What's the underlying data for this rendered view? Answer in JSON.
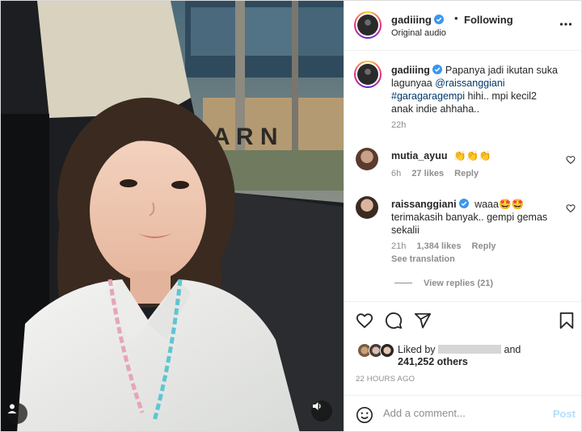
{
  "post": {
    "username": "gadiiing",
    "follow_dot": "•",
    "follow_status": "Following",
    "audio": "Original audio"
  },
  "caption": {
    "username": "gadiiing",
    "text_before": "Papanya jadi ikutan suka lagunyaa ",
    "mention": "@raissanggiani",
    "hashtag": "#garagaragempi",
    "text_after": " hihi.. mpi kecil2 anak indie ahhaha..",
    "time": "22h"
  },
  "comments": [
    {
      "username": "mutia_ayuu",
      "text": "👏👏👏",
      "time": "6h",
      "likes": "27 likes",
      "reply": "Reply"
    },
    {
      "username": "raissanggiani",
      "text": "waaa🤩🤩 terimakasih banyak.. gempi gemas sekalii",
      "time": "21h",
      "likes": "1,384 likes",
      "reply": "Reply",
      "see_translation": "See translation",
      "view_replies": "View replies (21)"
    }
  ],
  "likes": {
    "prefix": "Liked by",
    "suffix": "and",
    "count": "241,252 others"
  },
  "timestamp": "22 HOURS AGO",
  "add_comment": {
    "placeholder": "Add a comment...",
    "post_label": "Post"
  },
  "colors": {
    "verified": "#3897f0",
    "link": "#00376b",
    "muted": "#8e8e8e",
    "post_disabled": "#b2dffc"
  },
  "icons": [
    "more-icon",
    "verified-icon",
    "heart-icon",
    "comment-icon",
    "share-icon",
    "bookmark-icon",
    "smile-icon",
    "tag-user-icon",
    "sound-icon"
  ]
}
